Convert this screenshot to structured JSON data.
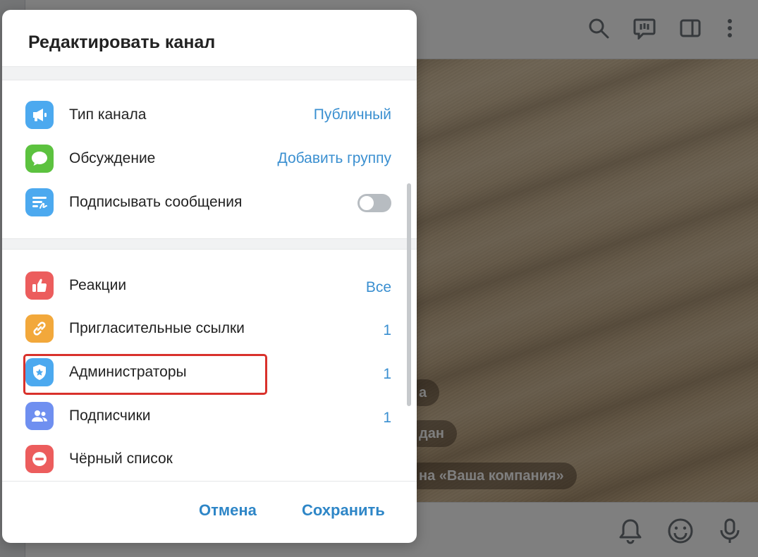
{
  "background": {
    "service_messages": [
      "а",
      "дан",
      "на «Ваша компания»"
    ]
  },
  "dialog": {
    "title": "Редактировать канал",
    "section1": [
      {
        "label": "Тип канала",
        "value": "Публичный",
        "icon": "megaphone-icon",
        "color": "#4ca9ef"
      },
      {
        "label": "Обсуждение",
        "value": "Добавить группу",
        "icon": "chat-bubble-icon",
        "color": "#5cc23f"
      },
      {
        "label": "Подписывать сообщения",
        "icon": "signature-icon",
        "color": "#4ca9ef",
        "toggle_on": false
      }
    ],
    "section2": [
      {
        "label": "Реакции",
        "value": "Все",
        "icon": "thumbs-up-icon",
        "color": "#ec5d5d"
      },
      {
        "label": "Пригласительные ссылки",
        "value": "1",
        "icon": "link-icon",
        "color": "#f2a83b"
      },
      {
        "label": "Администраторы",
        "value": "1",
        "icon": "shield-star-icon",
        "color": "#4ca9ef"
      },
      {
        "label": "Подписчики",
        "value": "1",
        "icon": "users-icon",
        "color": "#6f8ff0"
      },
      {
        "label": "Чёрный список",
        "icon": "block-icon",
        "color": "#ec5d5d"
      }
    ],
    "cancel_label": "Отмена",
    "save_label": "Сохранить",
    "highlight_color": "#d9312b",
    "accent_color": "#2e86c7"
  }
}
